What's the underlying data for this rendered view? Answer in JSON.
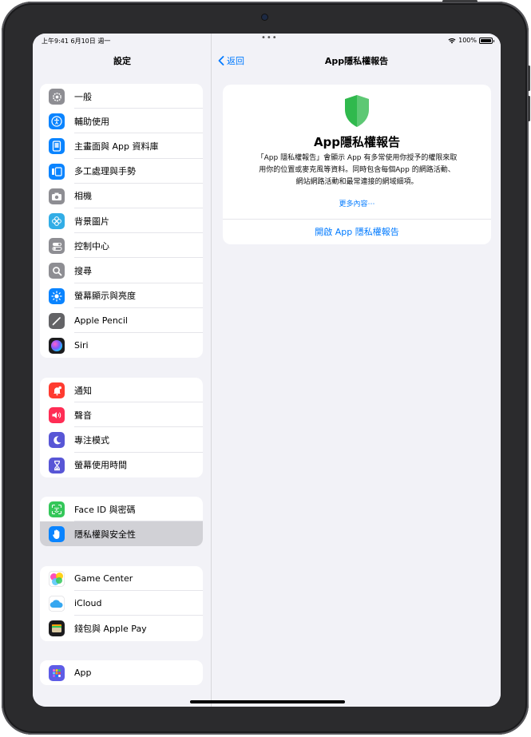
{
  "status_bar": {
    "time": "上午9:41  6月10日 週一",
    "dots": "•••",
    "battery": "100%"
  },
  "sidebar": {
    "title": "設定",
    "groups": [
      {
        "items": [
          {
            "label": "一般",
            "icon": "gear-icon",
            "color": "#8e8e93"
          },
          {
            "label": "輔助使用",
            "icon": "accessibility-icon",
            "color": "#0a84ff"
          },
          {
            "label": "主畫面與 App 資料庫",
            "icon": "home-screen-icon",
            "color": "#0a84ff"
          },
          {
            "label": "多工處理與手勢",
            "icon": "multitasking-icon",
            "color": "#0a84ff"
          },
          {
            "label": "相機",
            "icon": "camera-icon",
            "color": "#8e8e93"
          },
          {
            "label": "背景圖片",
            "icon": "wallpaper-icon",
            "color": "#32ade6"
          },
          {
            "label": "控制中心",
            "icon": "control-center-icon",
            "color": "#8e8e93"
          },
          {
            "label": "搜尋",
            "icon": "search-icon",
            "color": "#8e8e93"
          },
          {
            "label": "螢幕顯示與亮度",
            "icon": "brightness-icon",
            "color": "#0a84ff"
          },
          {
            "label": "Apple Pencil",
            "icon": "pencil-icon",
            "color": "#636366"
          },
          {
            "label": "Siri",
            "icon": "siri-icon",
            "color": "#1c1c1e"
          }
        ]
      },
      {
        "items": [
          {
            "label": "通知",
            "icon": "bell-icon",
            "color": "#ff3b30"
          },
          {
            "label": "聲音",
            "icon": "speaker-icon",
            "color": "#ff2d55"
          },
          {
            "label": "專注模式",
            "icon": "moon-icon",
            "color": "#5856d6"
          },
          {
            "label": "螢幕使用時間",
            "icon": "hourglass-icon",
            "color": "#5856d6"
          }
        ]
      },
      {
        "items": [
          {
            "label": "Face ID 與密碼",
            "icon": "face-id-icon",
            "color": "#34c759"
          },
          {
            "label": "隱私權與安全性",
            "icon": "hand-icon",
            "color": "#0a84ff",
            "selected": true
          }
        ]
      },
      {
        "items": [
          {
            "label": "Game Center",
            "icon": "game-center-icon",
            "color": "#ffffff"
          },
          {
            "label": "iCloud",
            "icon": "cloud-icon",
            "color": "#ffffff"
          },
          {
            "label": "錢包與 Apple Pay",
            "icon": "wallet-icon",
            "color": "#1c1c1e"
          }
        ]
      },
      {
        "items": [
          {
            "label": "App",
            "icon": "app-grid-icon",
            "color": "#5e5ce6"
          }
        ]
      }
    ]
  },
  "detail": {
    "back_label": "返回",
    "nav_title": "App隱私權報告",
    "card": {
      "title": "App隱私權報告",
      "description_lines": [
        "「App 隱私權報告」會顯示 App 有多常使用你授予的權限來取",
        "用你的位置或麥克風等資料。同時包含每個App 的網路活動、",
        "網站網路活動和最常連接的網域細項。"
      ],
      "more_link": "更多內容⋯",
      "open_button": "開啟 App 隱私權報告",
      "shield_color": "#30b94d"
    }
  }
}
